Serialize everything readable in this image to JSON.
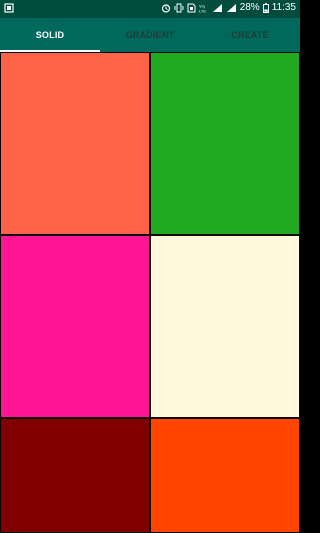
{
  "status_bar": {
    "battery_percent": "28%",
    "time": "11:35",
    "network": "Vo) LTE",
    "icons": [
      "notification-icon",
      "alarm-icon",
      "vibrate-icon",
      "sim-icon",
      "vo-lte-icon",
      "signal-icon",
      "battery-icon"
    ]
  },
  "tabs": [
    {
      "label": "SOLID",
      "active": true
    },
    {
      "label": "GRADIENT",
      "active": false
    },
    {
      "label": "CREATE",
      "active": false
    }
  ],
  "swatches": [
    {
      "color": "#ff6347"
    },
    {
      "color": "#22aa22"
    },
    {
      "color": "#ff1493"
    },
    {
      "color": "#fff8dc"
    },
    {
      "color": "#800000"
    },
    {
      "color": "#ff4500"
    }
  ],
  "colors": {
    "status_bar": "#004d40",
    "tab_bar": "#00695c",
    "indicator": "#ffffff"
  }
}
